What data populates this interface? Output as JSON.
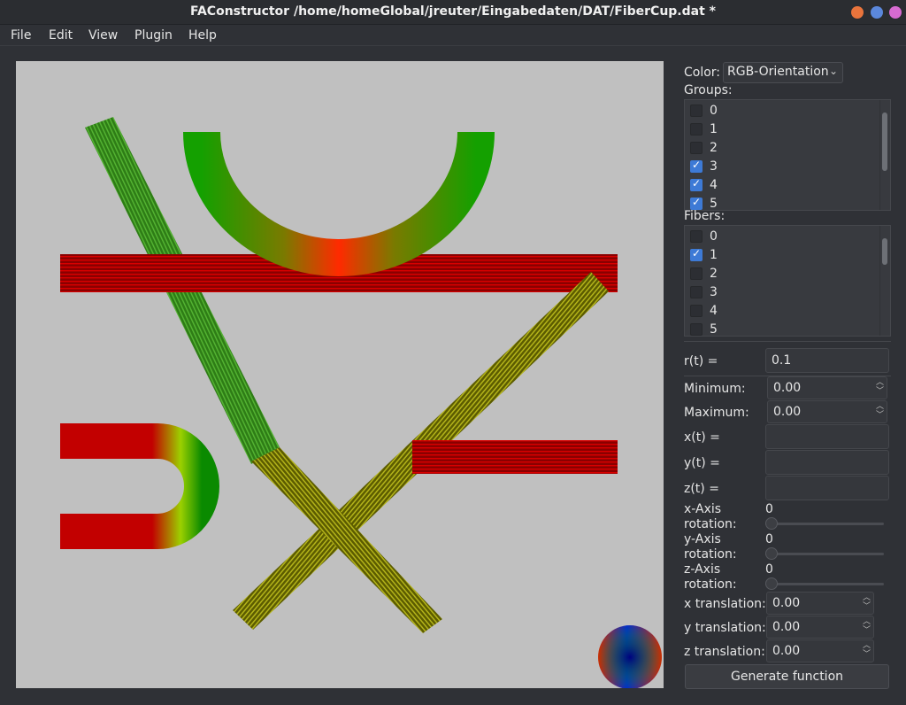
{
  "window": {
    "title": "FAConstructor /home/homeGlobal/jreuter/Eingabedaten/DAT/FiberCup.dat *"
  },
  "menu": {
    "items": [
      "File",
      "Edit",
      "View",
      "Plugin",
      "Help"
    ]
  },
  "panel": {
    "color_label": "Color:",
    "color_value": "RGB-Orientation",
    "groups_label": "Groups:",
    "groups": [
      {
        "label": "0",
        "checked": false
      },
      {
        "label": "1",
        "checked": false
      },
      {
        "label": "2",
        "checked": false
      },
      {
        "label": "3",
        "checked": true
      },
      {
        "label": "4",
        "checked": true
      },
      {
        "label": "5",
        "checked": true
      }
    ],
    "fibers_label": "Fibers:",
    "fibers": [
      {
        "label": "0",
        "checked": false
      },
      {
        "label": "1",
        "checked": true
      },
      {
        "label": "2",
        "checked": false
      },
      {
        "label": "3",
        "checked": false
      },
      {
        "label": "4",
        "checked": false
      },
      {
        "label": "5",
        "checked": false
      }
    ],
    "r_label": "r(t) =",
    "r_value": "0.1",
    "min_label": "Minimum:",
    "min_value": "0.00",
    "max_label": "Maximum:",
    "max_value": "0.00",
    "x_label": "x(t) =",
    "x_value": "",
    "y_label": "y(t) =",
    "y_value": "",
    "z_label": "z(t) =",
    "z_value": "",
    "x_rot_label_1": "x-Axis",
    "x_rot_label_2": "rotation:",
    "x_rot_value": "0",
    "y_rot_label_1": "y-Axis",
    "y_rot_label_2": "rotation:",
    "y_rot_value": "0",
    "z_rot_label_1": "z-Axis",
    "z_rot_label_2": "rotation:",
    "z_rot_value": "0",
    "xt_label": "x translation:",
    "xt_value": "0.00",
    "yt_label": "y translation:",
    "yt_value": "0.00",
    "zt_label": "z translation:",
    "zt_value": "0.00",
    "generate_label": "Generate function"
  },
  "colors": {
    "accent": "#3d7ad6",
    "viewport_bg": "#c0c0c0"
  }
}
